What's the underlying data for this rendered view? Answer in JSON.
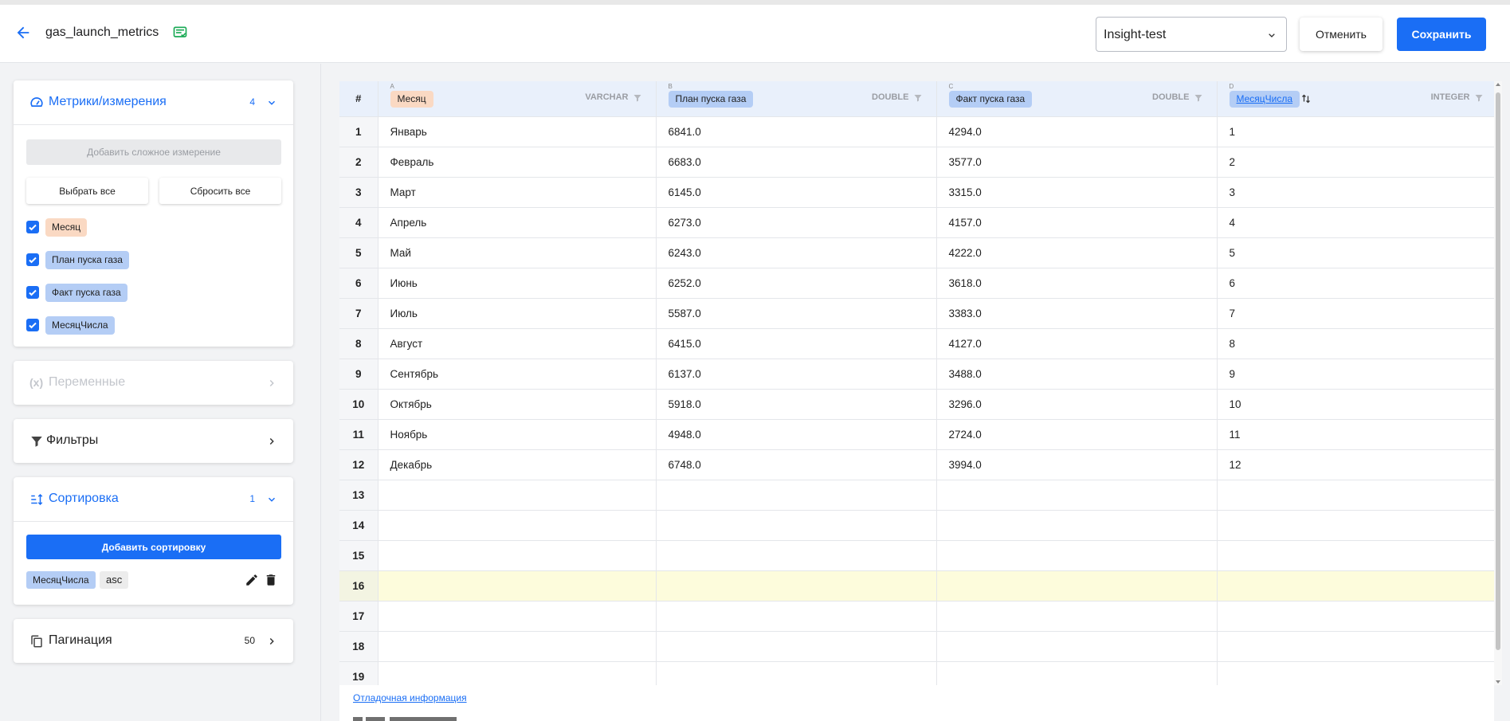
{
  "header": {
    "title": "gas_launch_metrics",
    "workspace_value": "Insight-test",
    "cancel_label": "Отменить",
    "save_label": "Сохранить",
    "accent_color": "#1a6ef5"
  },
  "sidebar": {
    "metrics": {
      "title": "Метрики/измерения",
      "count": "4",
      "add_complex_label": "Добавить сложное измерение",
      "select_all_label": "Выбрать все",
      "reset_all_label": "Сбросить все",
      "items": [
        {
          "label": "Месяц",
          "checked": true,
          "color": "#fad9c3"
        },
        {
          "label": "План пуска газа",
          "checked": true,
          "color": "#b4cdf5"
        },
        {
          "label": "Факт пуска газа",
          "checked": true,
          "color": "#b4cdf5"
        },
        {
          "label": "МесяцЧисла",
          "checked": true,
          "color": "#b4cdf5"
        }
      ]
    },
    "variables": {
      "icon_text": "(x)",
      "title": "Переменные"
    },
    "filters": {
      "title": "Фильтры"
    },
    "sorting": {
      "title": "Сортировка",
      "count": "1",
      "add_label": "Добавить сортировку",
      "field": "МесяцЧисла",
      "direction": "asc"
    },
    "pagination": {
      "title": "Пагинация",
      "count": "50"
    }
  },
  "table": {
    "num_header": "#",
    "columns": [
      {
        "letter": "A",
        "name": "Месяц",
        "type": "VARCHAR"
      },
      {
        "letter": "B",
        "name": "План пуска газа",
        "type": "DOUBLE"
      },
      {
        "letter": "C",
        "name": "Факт пуска газа",
        "type": "DOUBLE"
      },
      {
        "letter": "D",
        "name": "МесяцЧисла",
        "type": "INTEGER"
      }
    ],
    "row_numbers": [
      "1",
      "2",
      "3",
      "4",
      "5",
      "6",
      "7",
      "8",
      "9",
      "10",
      "11",
      "12",
      "13",
      "14",
      "15",
      "16",
      "17",
      "18",
      "19"
    ],
    "rows": [
      [
        "Январь",
        "6841.0",
        "4294.0",
        "1"
      ],
      [
        "Февраль",
        "6683.0",
        "3577.0",
        "2"
      ],
      [
        "Март",
        "6145.0",
        "3315.0",
        "3"
      ],
      [
        "Апрель",
        "6273.0",
        "4157.0",
        "4"
      ],
      [
        "Май",
        "6243.0",
        "4222.0",
        "5"
      ],
      [
        "Июнь",
        "6252.0",
        "3618.0",
        "6"
      ],
      [
        "Июль",
        "5587.0",
        "3383.0",
        "7"
      ],
      [
        "Август",
        "6415.0",
        "4127.0",
        "8"
      ],
      [
        "Сентябрь",
        "6137.0",
        "3488.0",
        "9"
      ],
      [
        "Октябрь",
        "5918.0",
        "3296.0",
        "10"
      ],
      [
        "Ноябрь",
        "4948.0",
        "2724.0",
        "11"
      ],
      [
        "Декабрь",
        "6748.0",
        "3994.0",
        "12"
      ]
    ],
    "highlighted_row": "16"
  },
  "debug_link": "Отладочная информация"
}
